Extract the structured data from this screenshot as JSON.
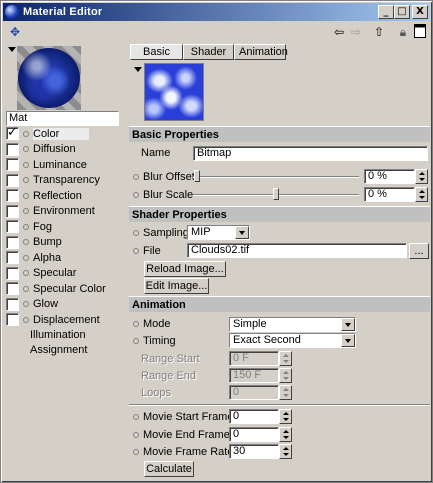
{
  "window": {
    "title": "Material Editor",
    "controls": [
      "_",
      "□",
      "X"
    ]
  },
  "toolbar": {
    "left_icon": "pin-icon",
    "right_icons": [
      "arrow-left-icon",
      "arrow-right-icon",
      "arrow-up-icon",
      "lock-icon",
      "window-icon"
    ]
  },
  "material": {
    "name": "Mat"
  },
  "channels": [
    {
      "label": "Color",
      "checked": true
    },
    {
      "label": "Diffusion",
      "checked": false
    },
    {
      "label": "Luminance",
      "checked": false
    },
    {
      "label": "Transparency",
      "checked": false
    },
    {
      "label": "Reflection",
      "checked": false
    },
    {
      "label": "Environment",
      "checked": false
    },
    {
      "label": "Fog",
      "checked": false
    },
    {
      "label": "Bump",
      "checked": false
    },
    {
      "label": "Alpha",
      "checked": false
    },
    {
      "label": "Specular",
      "checked": false
    },
    {
      "label": "Specular Color",
      "checked": false
    },
    {
      "label": "Glow",
      "checked": false
    },
    {
      "label": "Displacement",
      "checked": false
    }
  ],
  "extra_items": [
    "Illumination",
    "Assignment"
  ],
  "tabs": [
    "Basic",
    "Shader",
    "Animation"
  ],
  "basic": {
    "header": "Basic Properties",
    "name_label": "Name",
    "name_value": "Bitmap",
    "blur_offset_label": "Blur Offset",
    "blur_offset_value": "0 %",
    "blur_offset_level": 0,
    "blur_scale_label": "Blur Scale",
    "blur_scale_value": "0 %",
    "blur_scale_level": 0.5
  },
  "shader": {
    "header": "Shader Properties",
    "sampling_label": "Sampling",
    "sampling_value": "MIP",
    "file_label": "File",
    "file_value": "Clouds02.tif",
    "browse_label": "...",
    "reload_label": "Reload Image...",
    "edit_label": "Edit Image..."
  },
  "animation": {
    "header": "Animation",
    "mode_label": "Mode",
    "mode_value": "Simple",
    "timing_label": "Timing",
    "timing_value": "Exact Second",
    "range_start_label": "Range Start",
    "range_start_value": "0 F",
    "range_end_label": "Range End",
    "range_end_value": "150 F",
    "loops_label": "Loops",
    "loops_value": "0",
    "movie_start_label": "Movie Start Frame",
    "movie_start_value": "0",
    "movie_end_label": "Movie End Frame",
    "movie_end_value": "0",
    "frame_rate_label": "Movie Frame Rate",
    "frame_rate_value": "30",
    "calculate_label": "Calculate"
  }
}
